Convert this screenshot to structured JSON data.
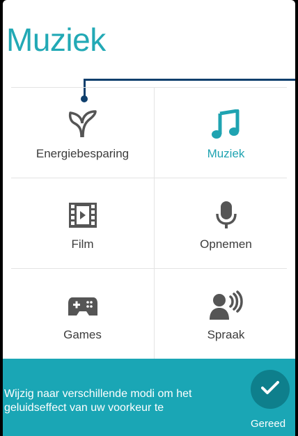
{
  "header": {
    "title": "Muziek"
  },
  "modes": [
    {
      "label": "Energiebesparing",
      "icon": "leaf-icon",
      "active": false
    },
    {
      "label": "Muziek",
      "icon": "music-note-icon",
      "active": true
    },
    {
      "label": "Film",
      "icon": "film-icon",
      "active": false
    },
    {
      "label": "Opnemen",
      "icon": "microphone-icon",
      "active": false
    },
    {
      "label": "Games",
      "icon": "gamepad-icon",
      "active": false
    },
    {
      "label": "Spraak",
      "icon": "speaker-voice-icon",
      "active": false
    }
  ],
  "tutorial": {
    "text": "Wijzig naar verschillende modi om het geluidseffect van uw voorkeur te",
    "done_label": "Gereed"
  },
  "colors": {
    "accent": "#22a9b5",
    "footer": "#1aa6b5",
    "done_button": "#0e7f8c",
    "pointer": "#0f3f6d"
  }
}
